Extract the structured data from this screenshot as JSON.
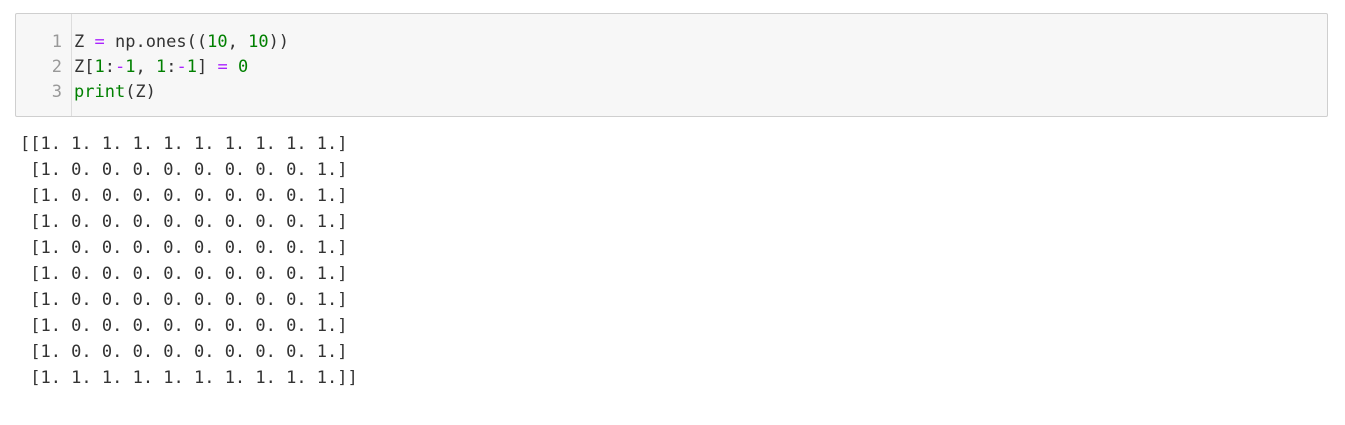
{
  "input_cell": {
    "line_numbers": [
      "1",
      "2",
      "3"
    ],
    "lines": [
      [
        {
          "text": "Z",
          "kind": "var"
        },
        {
          "text": " ",
          "kind": "ws"
        },
        {
          "text": "=",
          "kind": "op"
        },
        {
          "text": " np.ones((",
          "kind": "var"
        },
        {
          "text": "10",
          "kind": "num"
        },
        {
          "text": ", ",
          "kind": "var"
        },
        {
          "text": "10",
          "kind": "num"
        },
        {
          "text": "))",
          "kind": "var"
        }
      ],
      [
        {
          "text": "Z[",
          "kind": "var"
        },
        {
          "text": "1",
          "kind": "num"
        },
        {
          "text": ":",
          "kind": "var"
        },
        {
          "text": "-",
          "kind": "op"
        },
        {
          "text": "1",
          "kind": "num"
        },
        {
          "text": ", ",
          "kind": "var"
        },
        {
          "text": "1",
          "kind": "num"
        },
        {
          "text": ":",
          "kind": "var"
        },
        {
          "text": "-",
          "kind": "op"
        },
        {
          "text": "1",
          "kind": "num"
        },
        {
          "text": "] ",
          "kind": "var"
        },
        {
          "text": "=",
          "kind": "op"
        },
        {
          "text": " ",
          "kind": "ws"
        },
        {
          "text": "0",
          "kind": "num"
        }
      ],
      [
        {
          "text": "print",
          "kind": "builtin"
        },
        {
          "text": "(Z)",
          "kind": "var"
        }
      ]
    ]
  },
  "output_lines": [
    "[[1. 1. 1. 1. 1. 1. 1. 1. 1. 1.]",
    " [1. 0. 0. 0. 0. 0. 0. 0. 0. 1.]",
    " [1. 0. 0. 0. 0. 0. 0. 0. 0. 1.]",
    " [1. 0. 0. 0. 0. 0. 0. 0. 0. 1.]",
    " [1. 0. 0. 0. 0. 0. 0. 0. 0. 1.]",
    " [1. 0. 0. 0. 0. 0. 0. 0. 0. 1.]",
    " [1. 0. 0. 0. 0. 0. 0. 0. 0. 1.]",
    " [1. 0. 0. 0. 0. 0. 0. 0. 0. 1.]",
    " [1. 0. 0. 0. 0. 0. 0. 0. 0. 1.]",
    " [1. 1. 1. 1. 1. 1. 1. 1. 1. 1.]]"
  ],
  "colors": {
    "cell_background": "#f7f7f7",
    "cell_border": "#cfcfcf",
    "line_number": "#999999",
    "number_literal": "#008000",
    "builtin": "#008000",
    "operator": "#aa22ff",
    "text": "#333333"
  }
}
